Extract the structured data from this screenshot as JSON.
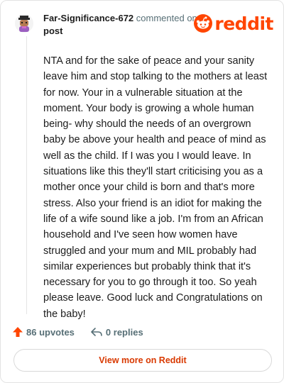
{
  "header": {
    "username": "Far-Significance-672",
    "commented_text": "commented on",
    "post_link": "post",
    "logo_text": "reddit"
  },
  "comment": {
    "body": "NTA and for the sake of peace and your sanity leave him and stop talking to the mothers at least for now. Your in a vulnerable situation at the moment. Your body is growing a whole human being- why should the needs of an overgrown baby be above your health and peace of mind as well as the child. If I was you I would leave. In situations like this they'll start criticising you as a mother once your child is born and that's more stress. Also your friend is an idiot for making the life of a wife sound like a job. I'm from an African household and I've seen how women have struggled and your mum and MIL probably had similar experiences but probably think that it's necessary for you to go through it too. So yeah please leave. Good luck and Congratulations on the baby!"
  },
  "actions": {
    "upvotes_label": "86 upvotes",
    "replies_label": "0 replies",
    "upvote_icon": "upvote-arrow-icon",
    "reply_icon": "reply-arrow-icon"
  },
  "footer": {
    "view_more_label": "View more on Reddit"
  },
  "colors": {
    "brand": "#ff4500",
    "link": "#d93900",
    "muted": "#576f76"
  }
}
